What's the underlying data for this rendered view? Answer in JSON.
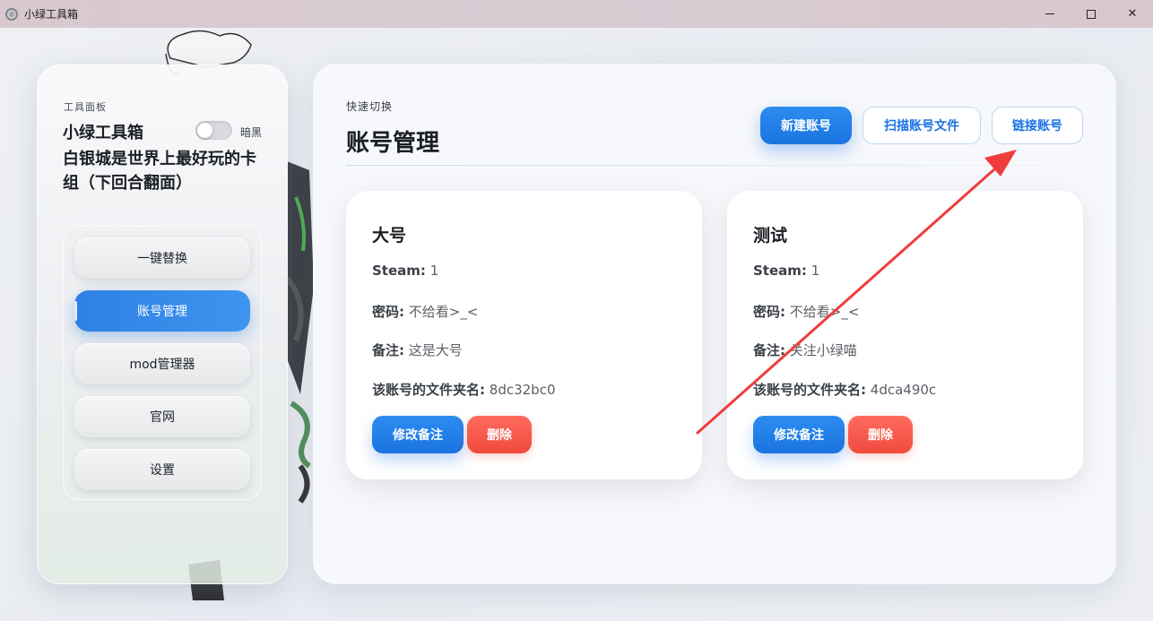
{
  "window": {
    "title": "小绿工具箱"
  },
  "sidebar": {
    "label": "工具面板",
    "title": "小绿工具箱",
    "dark_toggle_label": "暗黑",
    "dark_mode_on": false,
    "motto": "白银城是世界上最好玩的卡组（下回合翻面）",
    "nav": [
      {
        "label": "一键替换",
        "active": false
      },
      {
        "label": "账号管理",
        "active": true
      },
      {
        "label": "mod管理器",
        "active": false
      },
      {
        "label": "官网",
        "active": false
      },
      {
        "label": "设置",
        "active": false
      }
    ]
  },
  "main": {
    "subtitle": "快速切换",
    "title": "账号管理",
    "buttons": {
      "new": "新建账号",
      "scan": "扫描账号文件",
      "link": "链接账号"
    },
    "cards": [
      {
        "name": "大号",
        "steam_label": "Steam:",
        "steam_value": "1",
        "password_label": "密码:",
        "password_value": "不给看>_<",
        "note_label": "备注:",
        "note_value": "这是大号",
        "folder_label": "该账号的文件夹名:",
        "folder_value": "8dc32bc0",
        "edit_label": "修改备注",
        "delete_label": "删除"
      },
      {
        "name": "测试",
        "steam_label": "Steam:",
        "steam_value": "1",
        "password_label": "密码:",
        "password_value": "不给看>_<",
        "note_label": "备注:",
        "note_value": "关注小绿喵",
        "folder_label": "该账号的文件夹名:",
        "folder_value": "4dca490c",
        "edit_label": "修改备注",
        "delete_label": "删除"
      }
    ]
  },
  "colors": {
    "accent": "#1a74e0",
    "danger": "#f04a3e",
    "annotation_arrow": "#f03c3c"
  }
}
